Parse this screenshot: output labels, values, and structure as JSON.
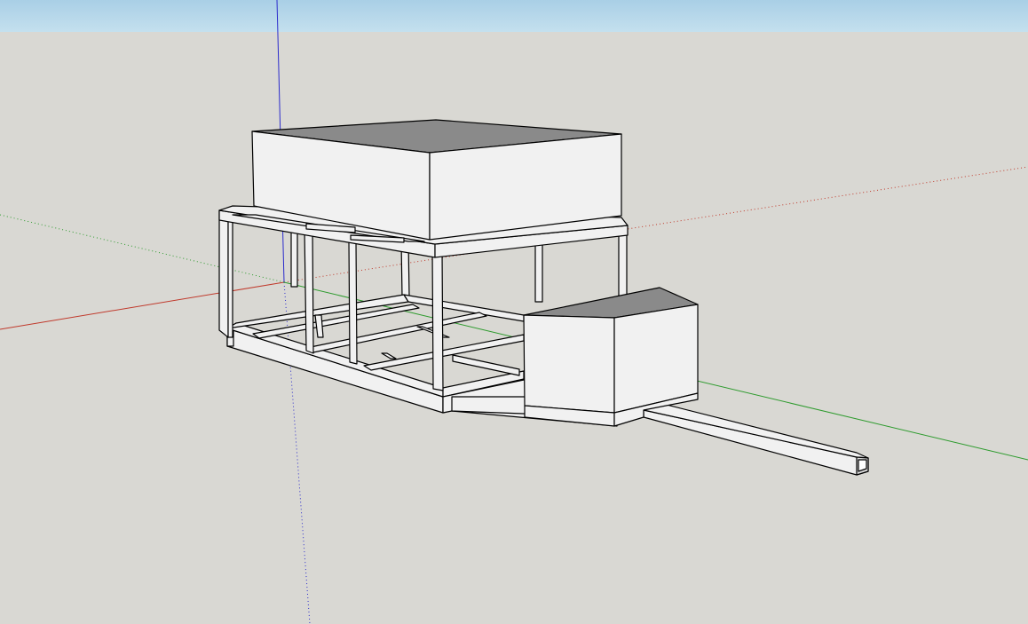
{
  "viewport": {
    "sky_color_top": "#a9cfe6",
    "sky_color_bottom": "#c4e0ee",
    "ground_color": "#d9d8d3",
    "axis_colors": {
      "red": "#c0392b",
      "green": "#2e9b2e",
      "blue": "#2b2bcc"
    },
    "model_face_color": "#f1f1f1",
    "model_top_color": "#8a8a8a",
    "model_edge_color": "#000000"
  }
}
